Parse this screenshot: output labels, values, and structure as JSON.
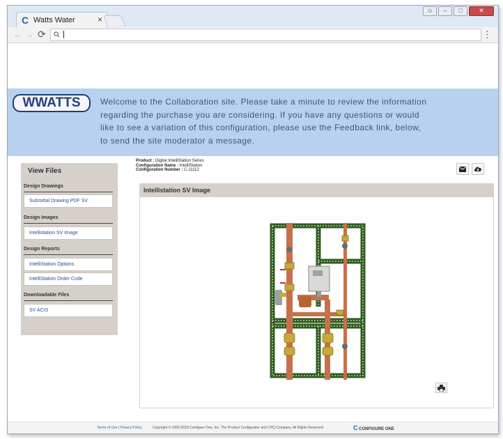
{
  "browser": {
    "tab_icon": "C",
    "tab_title": "Watts Water",
    "tab_close": "×",
    "address_value": "",
    "search_icon": "search-icon",
    "menu_icon": "⋮"
  },
  "brand": {
    "logo_text": "WWATTS"
  },
  "hero": {
    "welcome": "Welcome to the Collaboration site. Please take a minute to review the information regarding the purchase you are considering. If you have any questions or would like to see a variation of this configuration, please use the Feedback link, below, to send the site moderator a message."
  },
  "sidebar": {
    "title": "View Files",
    "sections": [
      {
        "heading": "Design Drawings",
        "items": [
          "Submittal Drawing PDF SV"
        ]
      },
      {
        "heading": "Design Images",
        "items": [
          "Intellistation SV Image"
        ]
      },
      {
        "heading": "Design Reports",
        "items": [
          "IntelliStation Options",
          "IntelliStation Order Code"
        ]
      },
      {
        "heading": "Downloadable Files",
        "items": [
          "SV ACIS"
        ]
      }
    ]
  },
  "product": {
    "product_label": "Product :",
    "product_value": "Digital IntelliStation Series",
    "config_name_label": "Configuration Name :",
    "config_name_value": "IntelliStation",
    "config_number_label": "Configuration Number :",
    "config_number_value": "C-11112"
  },
  "actions": {
    "email_icon": "envelope-icon",
    "download_icon": "cloud-download-icon"
  },
  "panel": {
    "title": "Intellistation SV Image",
    "print_icon": "printer-icon"
  },
  "footer": {
    "links": "Terms of Use | Privacy Policy",
    "copyright": "Copyright © 2000-2018 Configure One, Inc. The Product Configurator and CPQ Company. All Rights Reserved.",
    "brand_mark": "C",
    "brand": "CONFIGURE ONE"
  },
  "colors": {
    "hero_bg": "#b8d1ee",
    "sidebar_bg": "#d5d1ca",
    "link": "#1f4f96",
    "frame_green": "#2f5d1f",
    "pipe_copper": "#c8704a"
  }
}
